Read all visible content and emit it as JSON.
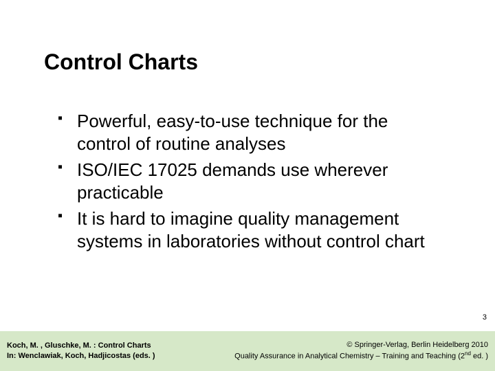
{
  "title": "Control Charts",
  "bullets": [
    "Powerful, easy-to-use technique for the control of routine analyses",
    "ISO/IEC 17025 demands use wherever practicable",
    "It is hard to imagine quality management systems in laboratories without control chart"
  ],
  "page_number": "3",
  "footer": {
    "left_line1": "Koch, M. , Gluschke, M. : Control Charts",
    "left_line2": "In:  Wenclawiak, Koch, Hadjicostas (eds. )",
    "right_line1": "© Springer-Verlag, Berlin Heidelberg 2010",
    "right_line2_pre": "Quality Assurance in Analytical Chemistry – Training and Teaching (2",
    "right_line2_sup": "nd",
    "right_line2_post": " ed. )"
  }
}
